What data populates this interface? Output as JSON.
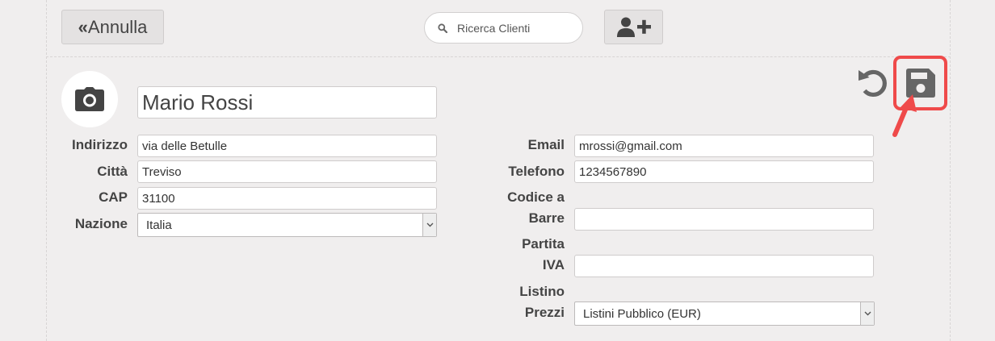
{
  "toolbar": {
    "cancel_label": "Annulla",
    "search_placeholder": "Ricerca Clienti"
  },
  "customer": {
    "name": "Mario Rossi"
  },
  "left_fields": {
    "address_label": "Indirizzo",
    "address_value": "via delle Betulle",
    "city_label": "Città",
    "city_value": "Treviso",
    "zip_label": "CAP",
    "zip_value": "31100",
    "country_label": "Nazione",
    "country_value": "Italia"
  },
  "right_fields": {
    "email_label": "Email",
    "email_value": "mrossi@gmail.com",
    "phone_label": "Telefono",
    "phone_value": "1234567890",
    "barcode_label_line1": "Codice a",
    "barcode_label_line2": "Barre",
    "barcode_value": "",
    "vat_label_line1": "Partita",
    "vat_label_line2": "IVA",
    "vat_value": "",
    "pricelist_label_line1": "Listino",
    "pricelist_label_line2": "Prezzi",
    "pricelist_value": "Listini Pubblico (EUR)"
  },
  "icons": {
    "cancel": "double-chevron-left-icon",
    "search": "search-icon",
    "add_user": "user-plus-icon",
    "avatar": "camera-icon",
    "undo": "undo-icon",
    "save": "floppy-disk-icon",
    "annotation": "red-arrow-icon"
  },
  "colors": {
    "background": "#f0eeee",
    "button": "#e4e2e2",
    "highlight": "#ef4a4a",
    "icon": "#666666"
  }
}
